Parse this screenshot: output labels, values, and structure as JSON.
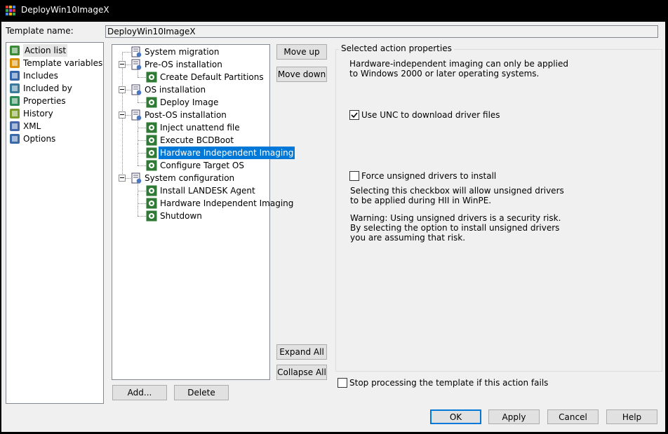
{
  "window": {
    "title": "DeployWin10ImageX"
  },
  "template_name": {
    "label": "Template name:",
    "value": "DeployWin10ImageX"
  },
  "sidebar": {
    "items": [
      {
        "label": "Action list",
        "icon": "action-list-icon",
        "selected": true
      },
      {
        "label": "Template variables",
        "icon": "template-variables-icon"
      },
      {
        "label": "Includes",
        "icon": "includes-icon"
      },
      {
        "label": "Included by",
        "icon": "included-by-icon"
      },
      {
        "label": "Properties",
        "icon": "properties-icon"
      },
      {
        "label": "History",
        "icon": "history-icon"
      },
      {
        "label": "XML",
        "icon": "xml-icon"
      },
      {
        "label": "Options",
        "icon": "options-icon"
      }
    ]
  },
  "tree": {
    "nodes": [
      {
        "label": "System migration",
        "level": 0
      },
      {
        "label": "Pre-OS installation",
        "level": 0
      },
      {
        "label": "Create Default Partitions",
        "level": 1
      },
      {
        "label": "OS installation",
        "level": 0
      },
      {
        "label": "Deploy Image",
        "level": 1
      },
      {
        "label": "Post-OS installation",
        "level": 0
      },
      {
        "label": "Inject unattend file",
        "level": 1
      },
      {
        "label": "Execute BCDBoot",
        "level": 1
      },
      {
        "label": "Hardware Independent Imaging",
        "level": 1,
        "selected": true
      },
      {
        "label": "Configure Target OS",
        "level": 1
      },
      {
        "label": "System configuration",
        "level": 0
      },
      {
        "label": "Install LANDESK Agent",
        "level": 1
      },
      {
        "label": "Hardware Independent Imaging",
        "level": 1
      },
      {
        "label": "Shutdown",
        "level": 1
      }
    ]
  },
  "buttons": {
    "move_up": "Move up",
    "move_down": "Move down",
    "expand_all": "Expand All",
    "collapse_all": "Collapse All",
    "add": "Add...",
    "delete": "Delete",
    "ok": "OK",
    "apply": "Apply",
    "cancel": "Cancel",
    "help": "Help"
  },
  "properties": {
    "group_title": "Selected action properties",
    "info_line1": "Hardware-independent imaging can only be applied",
    "info_line2": "to Windows 2000 or later operating systems.",
    "unc_label": "Use UNC to download driver files",
    "unc_checked": true,
    "unsigned_label": "Force unsigned drivers to install",
    "unsigned_checked": false,
    "unsigned_desc1": "Selecting this checkbox will allow unsigned drivers",
    "unsigned_desc2": "to be applied during HII in WinPE.",
    "warning1": "Warning: Using unsigned drivers is a security risk.",
    "warning2": "By selecting the option to install unsigned drivers",
    "warning3": "you are assuming that risk."
  },
  "stop_processing": {
    "label": "Stop processing the template if this action fails",
    "checked": false
  },
  "colors": {
    "selection": "#0078d7",
    "titlebar": "#000000",
    "dialog_bg": "#f0f0f0"
  }
}
